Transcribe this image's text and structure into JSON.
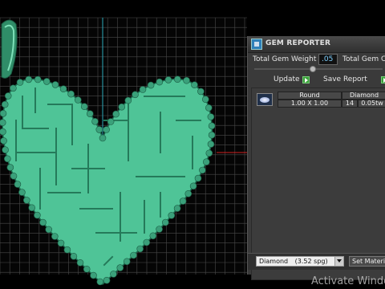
{
  "panel": {
    "title": "GEM REPORTER",
    "total_weight_label": "Total Gem Weight",
    "total_weight_value": ".05",
    "total_count_label": "Total Gem Count",
    "update_label": "Update",
    "save_report_label": "Save Report"
  },
  "gems": [
    {
      "shape": "Round",
      "material": "Diamond",
      "size": "1.00 X 1.00",
      "count": "14",
      "weight": "0.05tw"
    }
  ],
  "footer": {
    "material_select": "Diamond",
    "spg": "(3.52 spg)",
    "set_material_label": "Set Material"
  },
  "watermark": "Activate Windows",
  "colors": {
    "heart_fill": "#4fc497",
    "bead": "#3aa07a",
    "grid": "#4a4a4a",
    "accent_blue": "#7fd0ff"
  }
}
